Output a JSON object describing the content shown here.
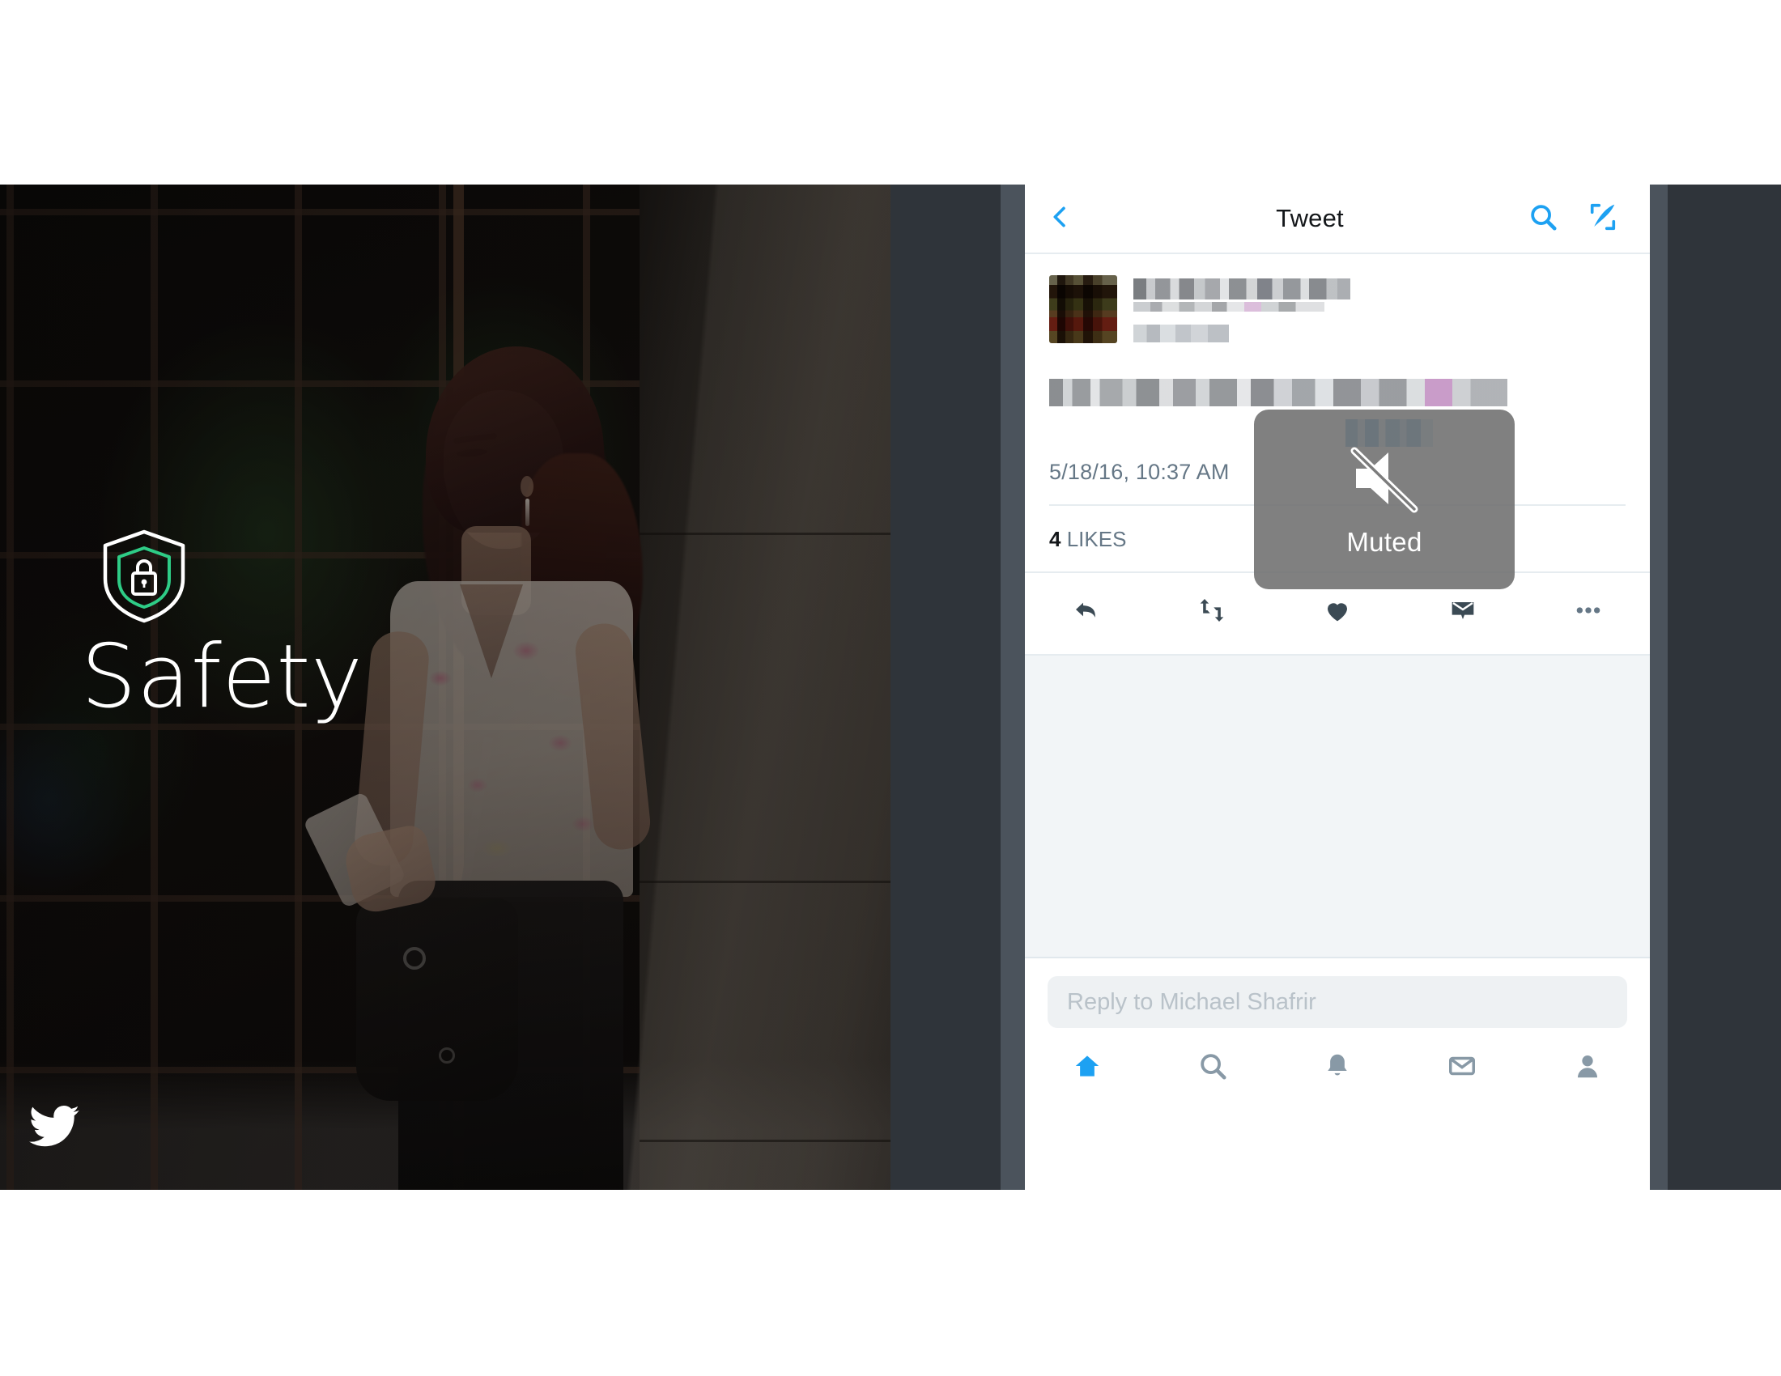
{
  "hero": {
    "wordmark": "Safety",
    "shield_icon": "shield-lock-icon",
    "shield_outer_color": "#ffffff",
    "shield_inner_color": "#2ecc86",
    "brand_logo_icon": "twitter-bird-icon",
    "brand_logo_color": "#ffffff",
    "photo_description": "woman-using-phone-photo"
  },
  "phone": {
    "navbar": {
      "back_icon": "chevron-left-icon",
      "title": "Tweet",
      "search_icon": "search-icon",
      "compose_icon": "compose-quill-icon",
      "accent_color": "#1da1f2"
    },
    "tweet": {
      "avatar_icon": "user-avatar-pixelated",
      "display_name": "",
      "handle": "",
      "body_line1": "",
      "body_line2": "",
      "hashtag": "",
      "timestamp": "5/18/16, 10:37 AM",
      "likes_count": "4",
      "likes_label": "LIKES"
    },
    "actions": [
      {
        "name": "reply-action",
        "icon": "reply-arrow-icon"
      },
      {
        "name": "retweet-action",
        "icon": "retweet-icon"
      },
      {
        "name": "like-action",
        "icon": "heart-icon"
      },
      {
        "name": "direct-message-action",
        "icon": "envelope-icon"
      },
      {
        "name": "more-action",
        "icon": "ellipsis-icon"
      }
    ],
    "toast": {
      "icon": "muted-speaker-icon",
      "label": "Muted",
      "background_color": "#6e6e6e",
      "text_color": "#ffffff"
    },
    "composer": {
      "placeholder": "Reply to Michael Shafrir"
    },
    "tabbar": [
      {
        "name": "tab-home",
        "icon": "home-icon",
        "active": true
      },
      {
        "name": "tab-search",
        "icon": "search-icon",
        "active": false
      },
      {
        "name": "tab-notifications",
        "icon": "bell-icon",
        "active": false
      },
      {
        "name": "tab-messages",
        "icon": "envelope-icon",
        "active": false
      },
      {
        "name": "tab-me",
        "icon": "profile-icon",
        "active": false
      }
    ]
  },
  "colors": {
    "twitter_blue": "#1da1f2",
    "text_dark": "#14171a",
    "text_muted": "#657786",
    "divider": "#e6ecf0",
    "panel_bg": "#f2f5f7",
    "bezel_dark": "#2f343a",
    "bezel_light": "#4b535c"
  }
}
